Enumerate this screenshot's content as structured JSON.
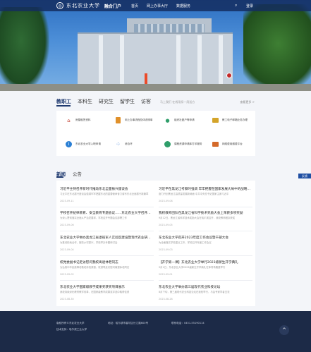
{
  "header": {
    "logo_mark": "◎",
    "logo_text": "东北农业大学",
    "portal": "融合门户",
    "nav": [
      "首页",
      "网上办事大厅",
      "数据服务"
    ],
    "login": "登录"
  },
  "services": {
    "tabs": [
      "教职工",
      "本科生",
      "研究生",
      "留学生",
      "访客"
    ],
    "active_tab": "教职工",
    "hint": "马上我们 在线用扣一用适方",
    "more": "查看更多 >",
    "items": [
      {
        "icon": "house-icon",
        "color": "#c0392b",
        "label": "房屋租赁资料"
      },
      {
        "icon": "document-icon",
        "color": "#e0902a",
        "label": "网上办事流程总体说明单"
      },
      {
        "icon": "person-icon",
        "color": "#2f9e6a",
        "label": "组织社团户等申请"
      },
      {
        "icon": "mail-icon",
        "color": "#d4a42a",
        "label": "教工电子邮箱业务办理"
      },
      {
        "icon": "info-icon",
        "color": "#2a7fd4",
        "label": "东北农业大学入职申请"
      },
      {
        "icon": "flow-icon",
        "color": "#2a6fd4",
        "label": "综合环"
      },
      {
        "icon": "globe-icon",
        "color": "#2f9e6a",
        "label": "课程资源申请库打印服务"
      },
      {
        "icon": "card-icon",
        "color": "#d46a2a",
        "label": "网络费用缴费平台"
      }
    ]
  },
  "news": {
    "tabs": [
      "新闻",
      "公告"
    ],
    "active_tab": "新闻",
    "side_tag": "反馈",
    "items": [
      {
        "title": "习近平主持召开新时代推动东北全面振兴座谈会",
        "desc": "习近平在东北振兴座谈会强调牢牢把握东北的重要使命奋力谱写东北全面振兴新篇章",
        "date": "2023-09-11"
      },
      {
        "title": "习近平在黑龙江考察时强调 牢牢把握在国家发展大局中的战略定位",
        "desc": "奋力开创黑龙江高质量发展新局面 中共中央总书记国家主席习近平",
        "date": "2023-09-08"
      },
      {
        "title": "学校召开纪律教育、安全教育专题会议……东北农业大学召开会议",
        "desc": "为深入贯彻落实全面从严治党要求，学校召开专题会议部署工作",
        "date": "2023-09-06"
      },
      {
        "title": "我校教师团队在黑龙江省科学技术奖励大会上荣获多项奖励",
        "desc": "9月12日，黑龙江省科学技术奖励大会在哈尔滨召开，我校教师团队获奖",
        "date": "2023-09-05"
      },
      {
        "title": "东北农业大学举办黑龙江省退役军人实验区建设暨现代农业研讨会",
        "desc": "为推动校地合作，服务乡村振兴，学校举办专题研讨会",
        "date": "2023-09-04"
      },
      {
        "title": "东北农业大学召开2023年度工作会议暨干部大会",
        "desc": "为全面落实学校重点工作，学校召开年度工作会议",
        "date": "2023-09-03"
      },
      {
        "title": "校党委副书记走访慰问我校离退休老同志",
        "desc": "为弘扬中华民族尊老敬老传统美德，校领导走访慰问离退休老同志",
        "date": "2023-09-02"
      },
      {
        "title": "【开学第一课】东北农业大学举行2023级新生开学典礼",
        "desc": "9月1日，东北农业大学2023级新生开学典礼在体育场隆重举行",
        "date": "2023-09-01"
      },
      {
        "title": "东北农业大学国家级教学成果奖获奖项目展示",
        "desc": "我校持续深化教育教学改革，在国家级教学成果奖评选中取得佳绩",
        "date": "2023-08-30"
      },
      {
        "title": "东北农业大学举办第三届现代农业科技论坛",
        "desc": "8月下旬，第三届现代农业科技论坛在我校举行，与会专家学者交流",
        "date": "2023-08-28"
      }
    ]
  },
  "footer": {
    "left1": "版权所有©东北农业大学",
    "left2": "技术支持：哈尔滨工业大学",
    "mid": "地址：哈尔滨市香坊区长江路600号",
    "right": "联系电话：0451-55190114"
  }
}
